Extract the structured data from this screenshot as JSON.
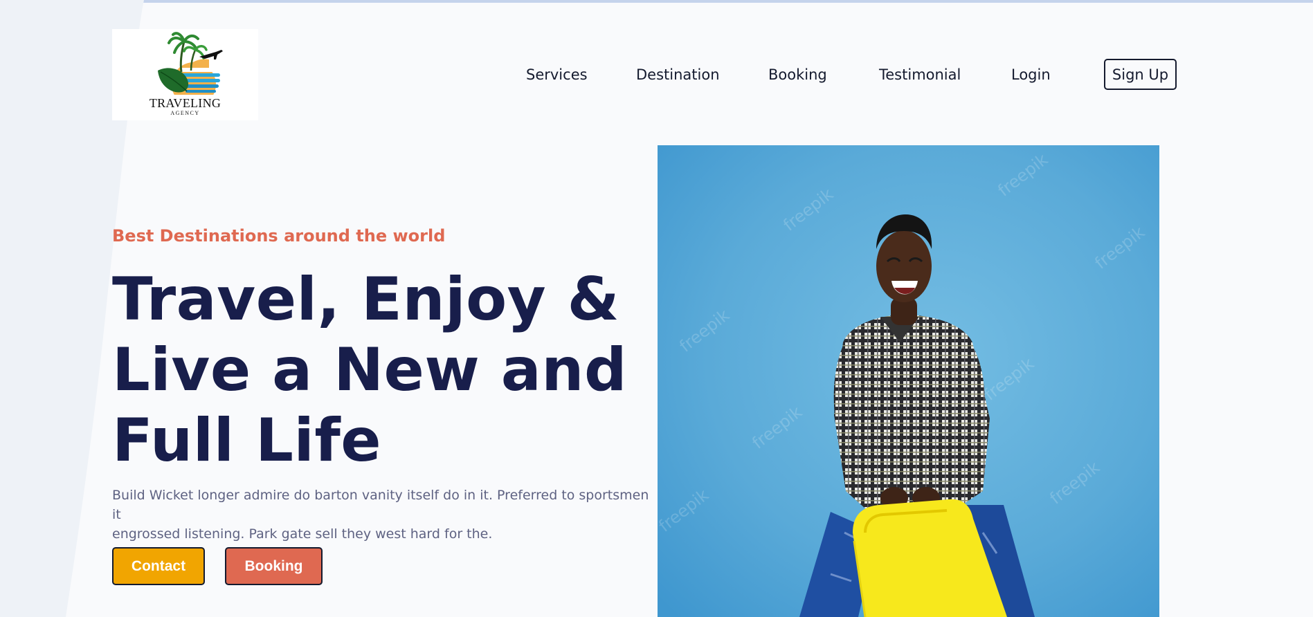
{
  "logo": {
    "title": "TRAVELING",
    "subtitle": "AGENCY"
  },
  "nav": {
    "items": [
      "Services",
      "Destination",
      "Booking",
      "Testimonial",
      "Login"
    ],
    "signup": "Sign Up"
  },
  "hero": {
    "tagline": "Best Destinations around the world",
    "headline_lines": [
      "Travel, Enjoy &",
      "Live a New and",
      "Full Life"
    ],
    "description_lines": [
      "Build Wicket longer admire do barton vanity itself do in it. Preferred to sportsmen it",
      "engrossed listening. Park gate sell they west hard for the."
    ],
    "buttons": {
      "contact": "Contact",
      "booking": "Booking"
    }
  },
  "image": {
    "watermark": "freepik"
  },
  "colors": {
    "accent_orange": "#df6951",
    "accent_yellow": "#f1a501",
    "headline_navy": "#181e4b",
    "body_gray": "#5e6282",
    "photo_blue": "#5aaad8"
  }
}
